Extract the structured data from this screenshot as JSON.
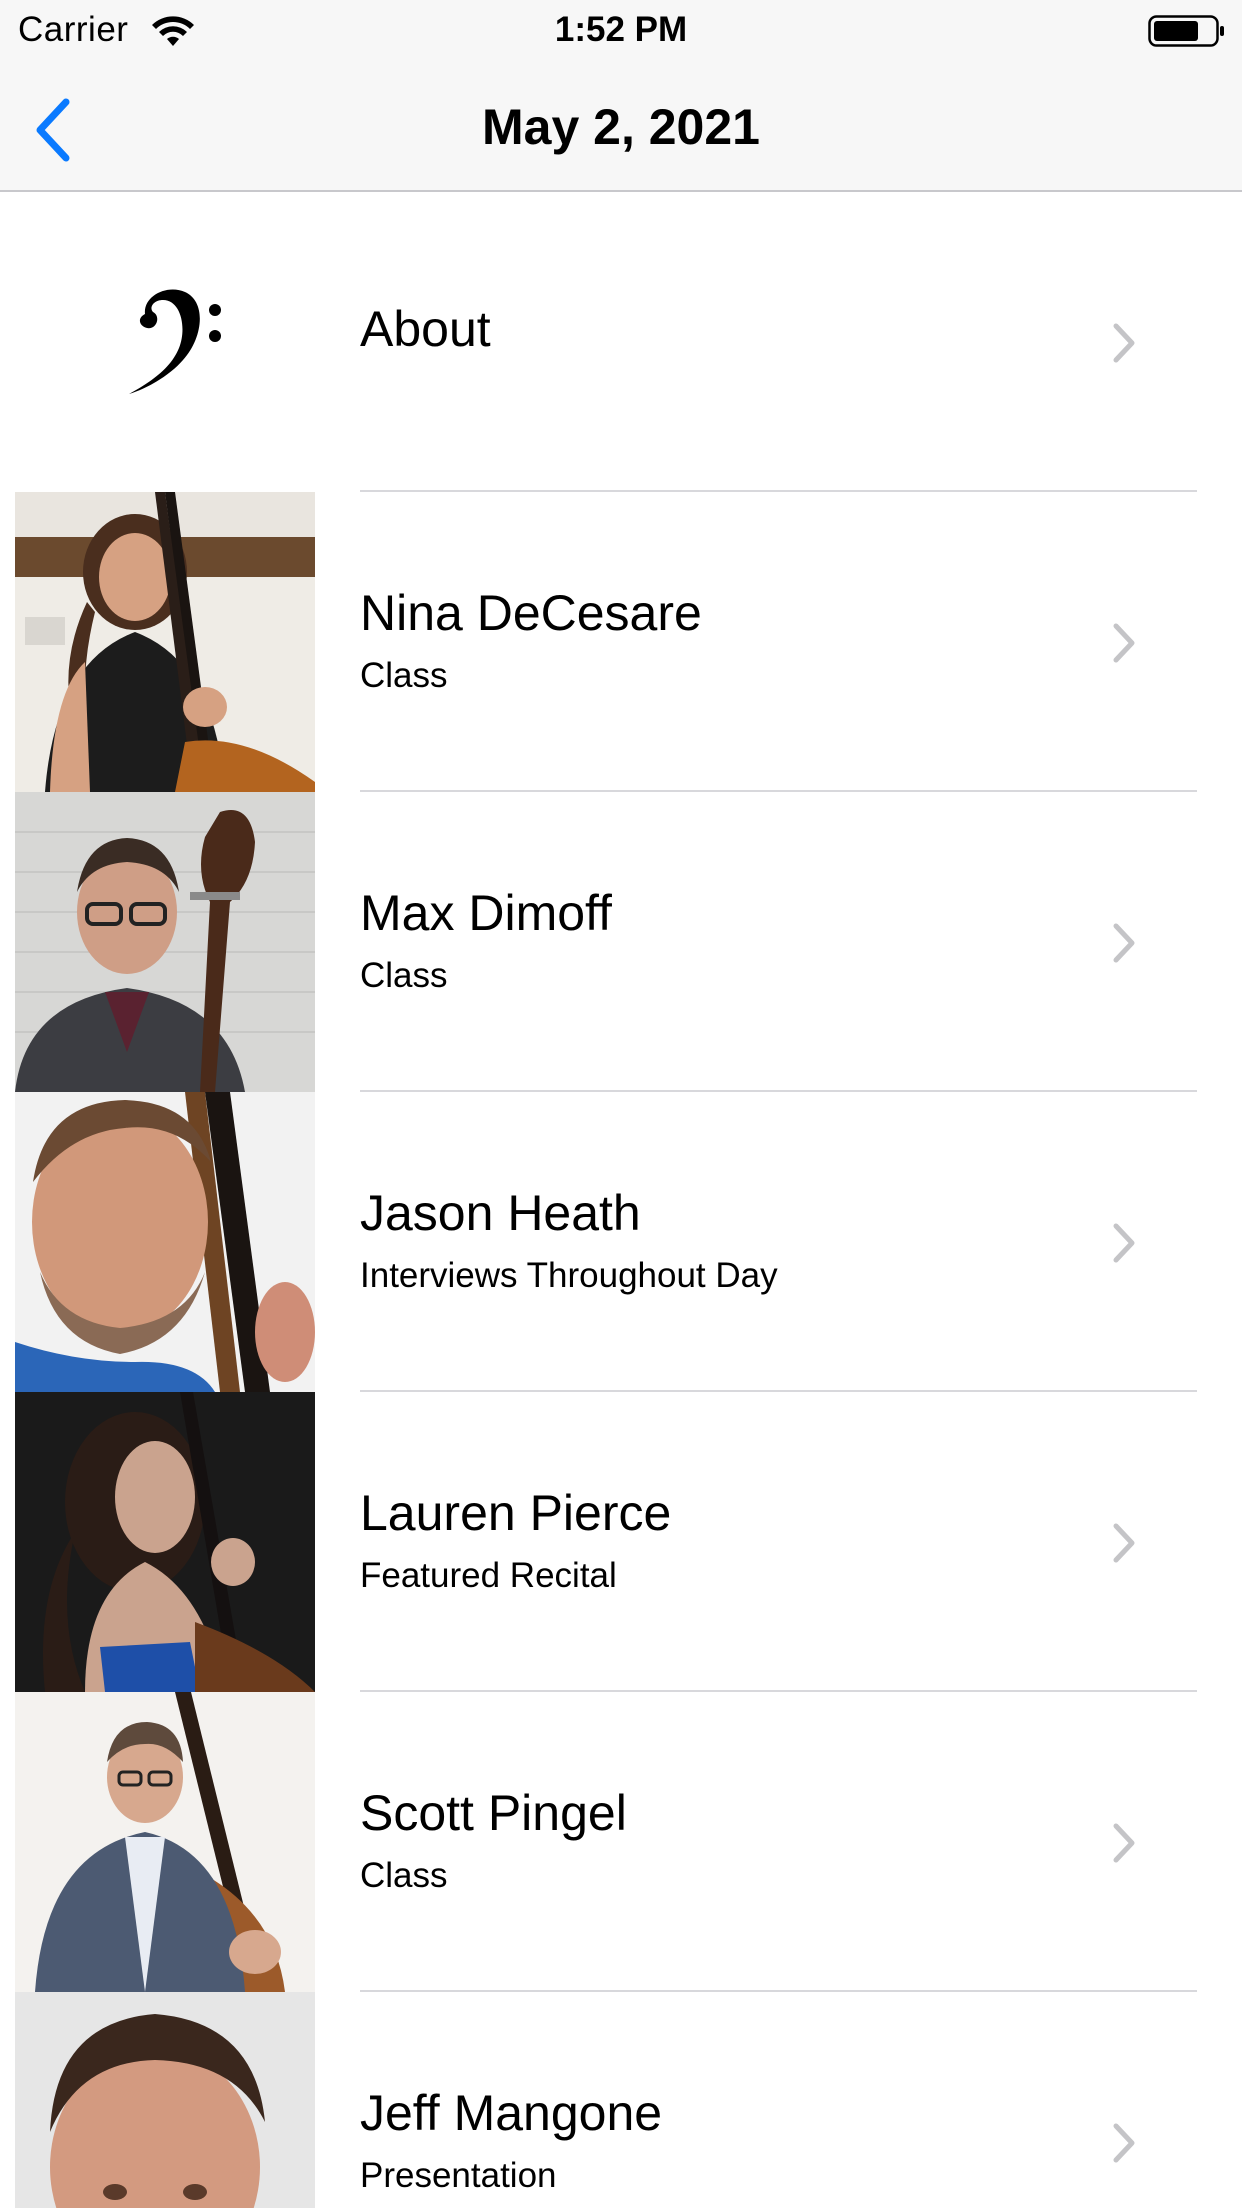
{
  "status_bar": {
    "carrier": "Carrier",
    "time": "1:52 PM"
  },
  "nav": {
    "title": "May 2, 2021",
    "back_icon": "chevron-left-icon",
    "accent_color": "#0a7aff"
  },
  "rows": [
    {
      "title": "About",
      "subtitle": "",
      "image": "bass-clef-icon"
    },
    {
      "title": "Nina DeCesare",
      "subtitle": "Class",
      "image": "photo"
    },
    {
      "title": "Max Dimoff",
      "subtitle": "Class",
      "image": "photo"
    },
    {
      "title": "Jason Heath",
      "subtitle": "Interviews Throughout Day",
      "image": "photo"
    },
    {
      "title": "Lauren Pierce",
      "subtitle": "Featured Recital",
      "image": "photo"
    },
    {
      "title": "Scott Pingel",
      "subtitle": "Class",
      "image": "photo"
    },
    {
      "title": "Jeff Mangone",
      "subtitle": "Presentation",
      "image": "photo"
    }
  ]
}
